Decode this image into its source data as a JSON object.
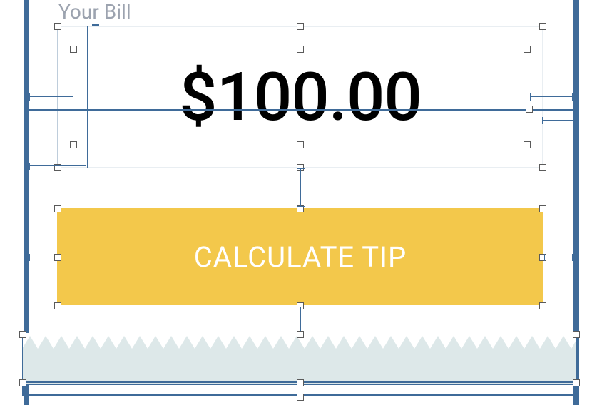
{
  "editor": {
    "label_text": "Your Bill",
    "bill_value": "$100.00",
    "calculate_label": "CALCULATE TIP",
    "colors": {
      "button_bg": "#f3c84b",
      "receipt_bg": "#dde8e9",
      "device_frame": "#3f6b99",
      "label_muted": "#9ca3af"
    }
  }
}
